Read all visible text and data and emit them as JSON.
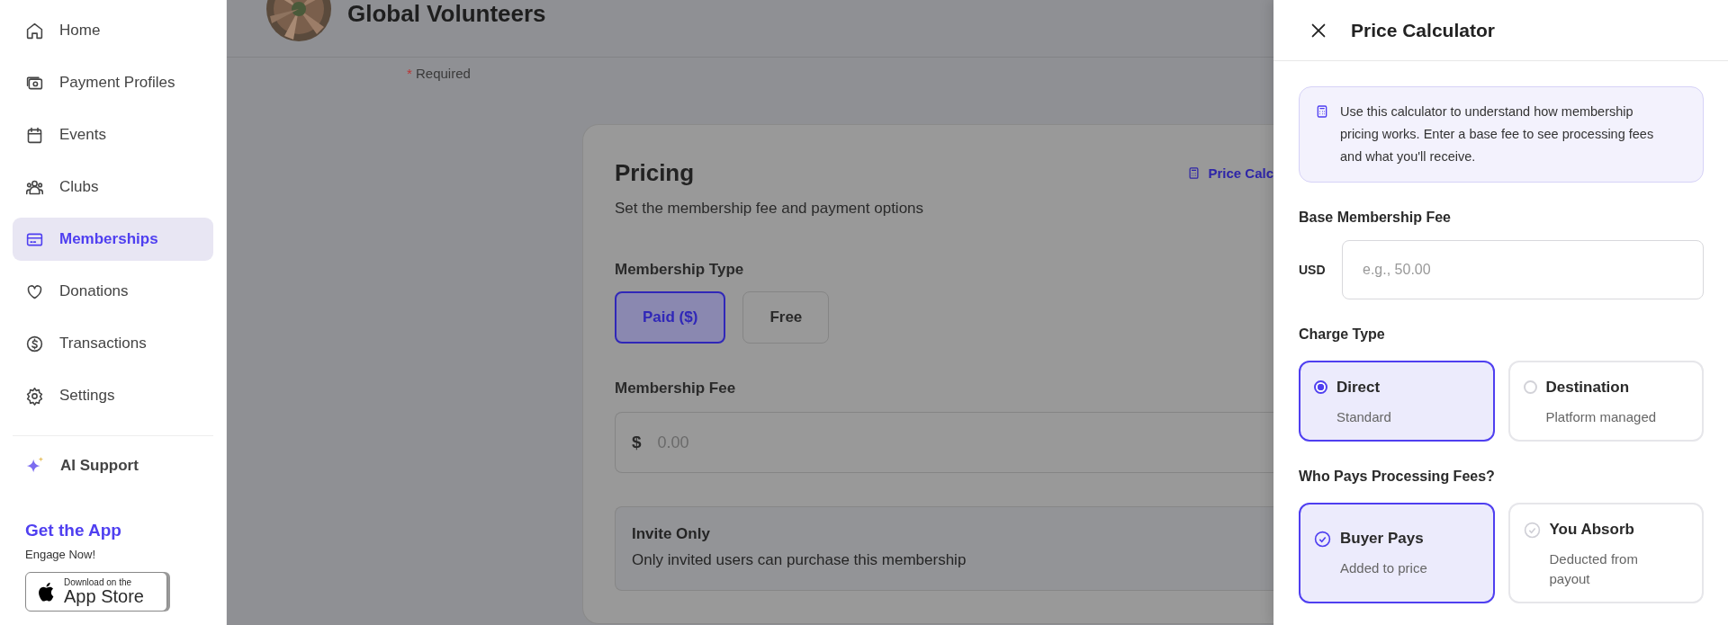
{
  "sidebar": {
    "items": [
      {
        "label": "Home",
        "selected": false
      },
      {
        "label": "Payment Profiles",
        "selected": false
      },
      {
        "label": "Events",
        "selected": false
      },
      {
        "label": "Clubs",
        "selected": false
      },
      {
        "label": "Memberships",
        "selected": true
      },
      {
        "label": "Donations",
        "selected": false
      },
      {
        "label": "Transactions",
        "selected": false
      },
      {
        "label": "Settings",
        "selected": false
      }
    ],
    "ai_support": "AI Support",
    "promo": {
      "title": "Get the App",
      "subtitle": "Engage Now!",
      "badge_small": "Download on the",
      "badge_large": "App Store"
    }
  },
  "header": {
    "title": "Global Volunteers",
    "required_mark": "*",
    "required_label": "Required"
  },
  "pricing": {
    "title": "Pricing",
    "link": "Price Calc",
    "subtitle": "Set the membership fee and payment options",
    "type_label": "Membership Type",
    "types": [
      {
        "label": "Paid ($)",
        "selected": true
      },
      {
        "label": "Free",
        "selected": false
      }
    ],
    "fee_label": "Membership Fee",
    "fee_prefix": "$",
    "fee_placeholder": "0.00",
    "invite": {
      "title": "Invite Only",
      "description": "Only invited users can purchase this membership"
    }
  },
  "calculator": {
    "title": "Price Calculator",
    "info": "Use this calculator to understand how membership pricing works. Enter a base fee to see processing fees and what you'll receive.",
    "base_label": "Base Membership Fee",
    "currency": "USD",
    "base_placeholder": "e.g., 50.00",
    "charge_label": "Charge Type",
    "charge_options": [
      {
        "title": "Direct",
        "subtitle": "Standard",
        "selected": true
      },
      {
        "title": "Destination",
        "subtitle": "Platform managed",
        "selected": false
      }
    ],
    "payer_label": "Who Pays Processing Fees?",
    "payer_options": [
      {
        "title": "Buyer Pays",
        "subtitle": "Added to price",
        "selected": true
      },
      {
        "title": "You Absorb",
        "subtitle": "Deducted from payout",
        "selected": false
      }
    ]
  }
}
